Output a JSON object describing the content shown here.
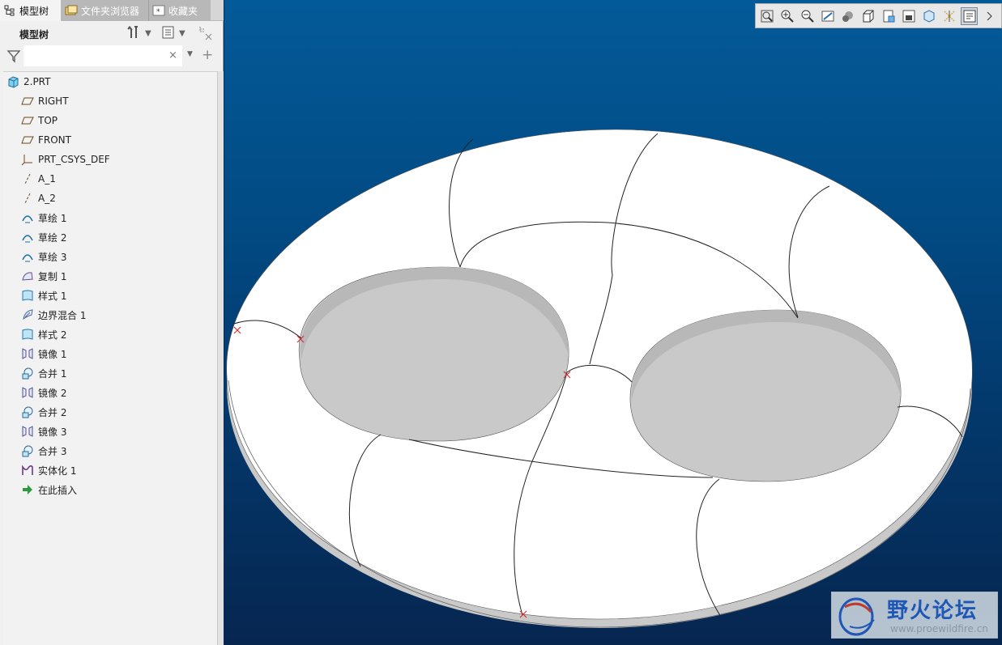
{
  "tabs": [
    {
      "label": "模型树",
      "icon": "tree-icon"
    },
    {
      "label": "文件夹浏览器",
      "icon": "folder-browser-icon"
    },
    {
      "label": "收藏夹",
      "icon": "favorites-icon"
    }
  ],
  "tree_header": {
    "label": "模型树"
  },
  "filter": {
    "value": "",
    "placeholder": "",
    "clear": "×"
  },
  "tree": {
    "root": {
      "label": "2.PRT",
      "icon": "part-icon"
    },
    "items": [
      {
        "label": "RIGHT",
        "icon": "datum-plane-icon"
      },
      {
        "label": "TOP",
        "icon": "datum-plane-icon"
      },
      {
        "label": "FRONT",
        "icon": "datum-plane-icon"
      },
      {
        "label": "PRT_CSYS_DEF",
        "icon": "csys-icon"
      },
      {
        "label": "A_1",
        "icon": "datum-axis-icon"
      },
      {
        "label": "A_2",
        "icon": "datum-axis-icon"
      },
      {
        "label": "草绘 1",
        "icon": "sketch-icon"
      },
      {
        "label": "草绘 2",
        "icon": "sketch-icon"
      },
      {
        "label": "草绘 3",
        "icon": "sketch-icon"
      },
      {
        "label": "复制 1",
        "icon": "copy-icon"
      },
      {
        "label": "样式 1",
        "icon": "style-icon"
      },
      {
        "label": "边界混合 1",
        "icon": "boundary-blend-icon"
      },
      {
        "label": "样式 2",
        "icon": "style-icon"
      },
      {
        "label": "镜像 1",
        "icon": "mirror-icon"
      },
      {
        "label": "合并 1",
        "icon": "merge-icon"
      },
      {
        "label": "镜像 2",
        "icon": "mirror-icon"
      },
      {
        "label": "合并 2",
        "icon": "merge-icon"
      },
      {
        "label": "镜像 3",
        "icon": "mirror-icon"
      },
      {
        "label": "合并 3",
        "icon": "merge-icon"
      },
      {
        "label": "实体化 1",
        "icon": "solidify-icon"
      },
      {
        "label": "在此插入",
        "icon": "insert-here-icon"
      }
    ]
  },
  "view_toolbar": [
    "refit-icon",
    "zoom-in-icon",
    "zoom-out-icon",
    "repaint-icon",
    "display-style-icon",
    "saved-orientation-icon",
    "view-manager-icon",
    "perspective-icon",
    "section-icon",
    "datum-display-icon",
    "annotation-display-icon",
    "more-icon"
  ],
  "watermark": {
    "title": "野火论坛",
    "url": "www.proewildfire.cn"
  },
  "colors": {
    "viewport_top": "#035a98",
    "viewport_bottom": "#062650",
    "model": "#ffffff",
    "marker": "#d23030",
    "watermark_blue": "#1f57b5"
  }
}
